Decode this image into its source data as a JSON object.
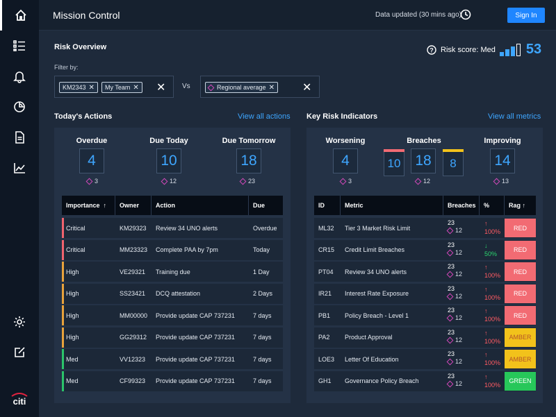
{
  "header": {
    "title": "Mission Control",
    "updated": "Data updated (30 mins ago)",
    "signin": "Sign In"
  },
  "overview": {
    "title": "Risk Overview",
    "risk_score_label": "Risk score: Med",
    "risk_score_value": "53",
    "filter_label": "Filter by:",
    "vs": "Vs",
    "left_chips": [
      "KM2343",
      "My Team"
    ],
    "right_chip": "Regional average"
  },
  "actions": {
    "title": "Today's Actions",
    "link": "View all actions",
    "stats": [
      {
        "label": "Overdue",
        "value": "4",
        "sub": "3"
      },
      {
        "label": "Due Today",
        "value": "10",
        "sub": "12"
      },
      {
        "label": "Due Tomorrow",
        "value": "18",
        "sub": "23"
      }
    ],
    "columns": [
      "Importance",
      "Owner",
      "Action",
      "Due"
    ],
    "sort_arrow": "↑",
    "rows": [
      {
        "importance": "Critical",
        "owner": "KM29323",
        "action": "Review 34 UNO alerts",
        "due": "Overdue",
        "level": "critical"
      },
      {
        "importance": "Critical",
        "owner": "MM23323",
        "action": "Complete PAA by 7pm",
        "due": "Today",
        "level": "critical"
      },
      {
        "importance": "High",
        "owner": "VE29321",
        "action": "Training due",
        "due": "1 Day",
        "level": "high"
      },
      {
        "importance": "High",
        "owner": "SS23421",
        "action": "DCQ attestation",
        "due": "2 Days",
        "level": "high"
      },
      {
        "importance": "High",
        "owner": "MM00000",
        "action": "Provide update CAP 737231",
        "due": "7 days",
        "level": "high"
      },
      {
        "importance": "High",
        "owner": "GG29312",
        "action": "Provide update CAP 737231",
        "due": "7 days",
        "level": "high"
      },
      {
        "importance": "Med",
        "owner": "VV12323",
        "action": "Provide update CAP 737231",
        "due": "7 days",
        "level": "med"
      },
      {
        "importance": "Med",
        "owner": "CF99323",
        "action": "Provide update CAP 737231",
        "due": "7 days",
        "level": "med"
      }
    ]
  },
  "kri": {
    "title": "Key Risk Indicators",
    "link": "View all metrics",
    "worsening": {
      "label": "Worsening",
      "value": "4",
      "sub": "3"
    },
    "breaches": {
      "label": "Breaches",
      "values": [
        "10",
        "18",
        "8"
      ],
      "sub": "12"
    },
    "improving": {
      "label": "Improving",
      "value": "14",
      "sub": "13"
    },
    "columns": [
      "ID",
      "Metric",
      "Breaches",
      "%",
      "Rag"
    ],
    "sort_arrow": "↑",
    "rows": [
      {
        "id": "ML32",
        "metric": "Tier 3 Market Risk Limit",
        "breaches": "23",
        "sub": "12",
        "arrow": "↑",
        "pct": "100%",
        "rag": "RED",
        "trend": "up"
      },
      {
        "id": "CR15",
        "metric": "Credit Limit Breaches",
        "breaches": "23",
        "sub": "12",
        "arrow": "↓",
        "pct": "50%",
        "rag": "RED",
        "trend": "down"
      },
      {
        "id": "PT04",
        "metric": "Review 34 UNO alerts",
        "breaches": "23",
        "sub": "12",
        "arrow": "↑",
        "pct": "100%",
        "rag": "RED",
        "trend": "up"
      },
      {
        "id": "IR21",
        "metric": "Interest Rate Exposure",
        "breaches": "23",
        "sub": "12",
        "arrow": "↑",
        "pct": "100%",
        "rag": "RED",
        "trend": "up"
      },
      {
        "id": "PB1",
        "metric": "Policy Breach - Level 1",
        "breaches": "23",
        "sub": "12",
        "arrow": "↑",
        "pct": "100%",
        "rag": "RED",
        "trend": "up"
      },
      {
        "id": "PA2",
        "metric": "Product Approval",
        "breaches": "23",
        "sub": "12",
        "arrow": "↑",
        "pct": "100%",
        "rag": "AMBER",
        "trend": "up"
      },
      {
        "id": "LOE3",
        "metric": "Letter Of Education",
        "breaches": "23",
        "sub": "12",
        "arrow": "↑",
        "pct": "100%",
        "rag": "AMBER",
        "trend": "up"
      },
      {
        "id": "GH1",
        "metric": "Governance Policy Breach",
        "breaches": "23",
        "sub": "12",
        "arrow": "↑",
        "pct": "100%",
        "rag": "GREEN",
        "trend": "up"
      }
    ]
  },
  "brand": {
    "logo": "citi"
  },
  "colors": {
    "accent": "#3ea6ff",
    "critical": "#f0636e",
    "high": "#e9a23b",
    "med": "#2bc46a",
    "red": "#f26b73",
    "amber": "#f2c21b",
    "green": "#27c75a"
  }
}
